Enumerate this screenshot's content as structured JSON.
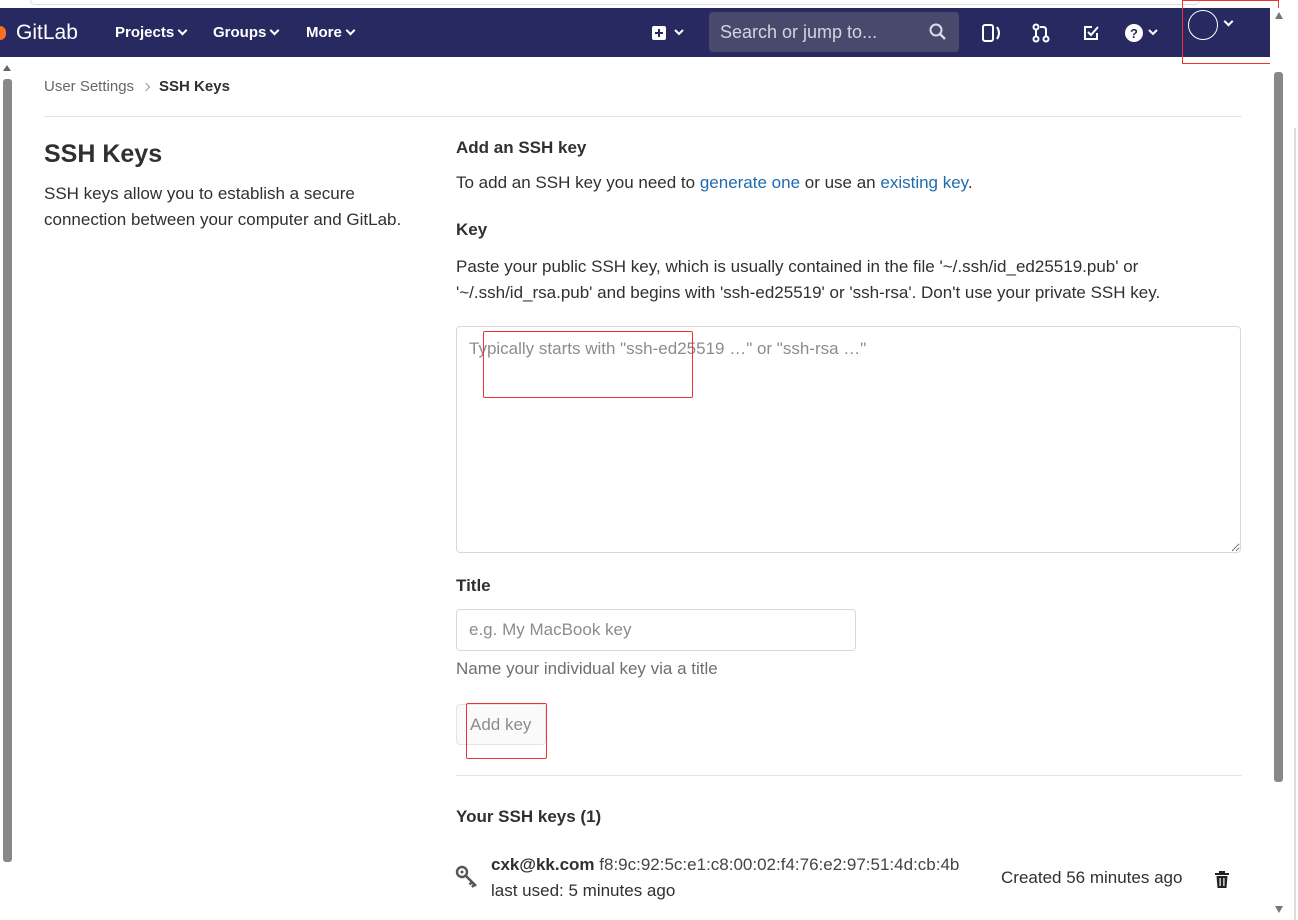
{
  "brand": {
    "name": "GitLab"
  },
  "nav": {
    "projects": "Projects",
    "groups": "Groups",
    "more": "More",
    "search_placeholder": "Search or jump to..."
  },
  "breadcrumb": {
    "parent": "User Settings",
    "current": "SSH Keys"
  },
  "left": {
    "title": "SSH Keys",
    "description": "SSH keys allow you to establish a secure connection between your computer and GitLab."
  },
  "form": {
    "add_heading": "Add an SSH key",
    "add_text_pre": "To add an SSH key you need to ",
    "generate_link": "generate one",
    "add_text_mid": " or use an ",
    "existing_link": "existing key",
    "add_text_post": ".",
    "key_label": "Key",
    "key_help": "Paste your public SSH key, which is usually contained in the file '~/.ssh/id_ed25519.pub' or '~/.ssh/id_rsa.pub' and begins with 'ssh-ed25519' or 'ssh-rsa'. Don't use your private SSH key.",
    "key_placeholder": "Typically starts with \"ssh-ed25519 …\" or \"ssh-rsa …\"",
    "key_value": "",
    "title_label": "Title",
    "title_placeholder": "e.g. My MacBook key",
    "title_value": "",
    "title_help": "Name your individual key via a title",
    "submit_label": "Add key"
  },
  "keys": {
    "heading": "Your SSH keys (1)",
    "items": [
      {
        "title": "cxk@kk.com",
        "fingerprint": "f8:9c:92:5c:e1:c8:00:02:f4:76:e2:97:51:4d:cb:4b",
        "last_used": "last used: 5 minutes ago",
        "created": "Created 56 minutes ago"
      }
    ]
  },
  "colors": {
    "navbar": "#292961",
    "link": "#1f6bad",
    "annotation": "#ee3333"
  }
}
